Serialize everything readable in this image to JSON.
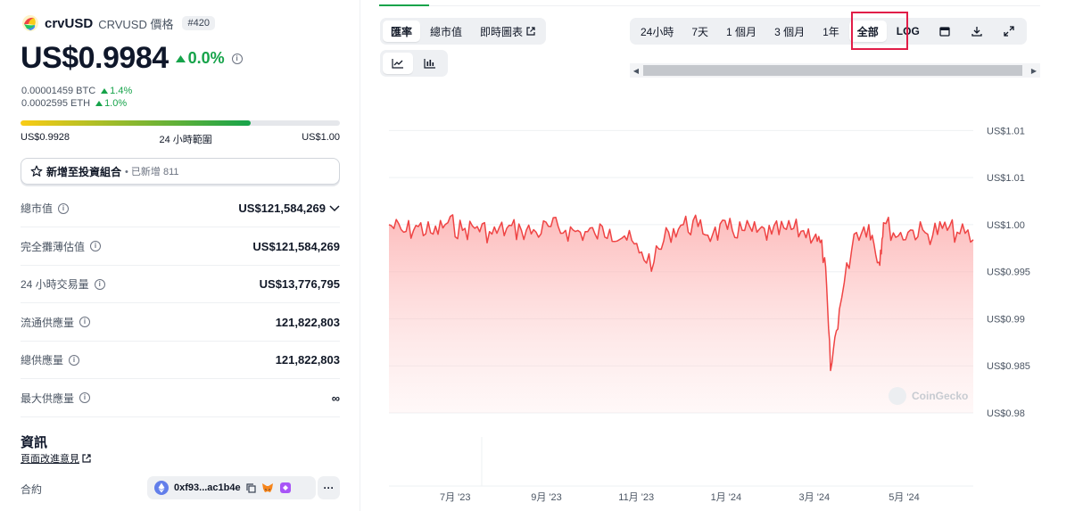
{
  "coin": {
    "name": "crvUSD",
    "symbol_label": "CRVUSD 價格",
    "rank": "#420",
    "price": "US$0.9984",
    "change_24h": "0.0%",
    "btc_price": "0.00001459 BTC",
    "btc_change": "1.4%",
    "eth_price": "0.0002595 ETH",
    "eth_change": "1.0%"
  },
  "range_24h": {
    "low": "US$0.9928",
    "label": "24 小時範圍",
    "high": "US$1.00",
    "fill_fraction": 0.72
  },
  "portfolio": {
    "label": "新增至投資組合",
    "added": "• 已新增 811"
  },
  "stats": [
    {
      "label": "總市值",
      "value": "US$121,584,269",
      "has_dropdown": true
    },
    {
      "label": "完全攤薄估值",
      "value": "US$121,584,269",
      "has_dropdown": false
    },
    {
      "label": "24 小時交易量",
      "value": "US$13,776,795",
      "has_dropdown": false
    },
    {
      "label": "流通供應量",
      "value": "121,822,803",
      "has_dropdown": false
    },
    {
      "label": "總供應量",
      "value": "121,822,803",
      "has_dropdown": false
    },
    {
      "label": "最大供應量",
      "value": "∞",
      "has_dropdown": false
    }
  ],
  "info": {
    "title": "資訊",
    "feedback": "頁面改進意見",
    "contract_label": "合約",
    "contract_address": "0xf93...ac1b4e"
  },
  "chart_controls": {
    "metric_tabs": [
      "匯率",
      "總市值",
      "即時圖表"
    ],
    "active_metric": 0,
    "chart_type_icons": [
      "line-chart-icon",
      "candlestick-chart-icon"
    ],
    "active_chart_type": 0,
    "ranges": [
      "24小時",
      "7天",
      "1 個月",
      "3 個月",
      "1年",
      "全部",
      "LOG"
    ],
    "active_range": 5,
    "tool_icons": [
      "calendar-icon",
      "download-icon",
      "fullscreen-icon"
    ]
  },
  "colors": {
    "line": "#ef4444",
    "positive": "#16a34a",
    "highlight": "#e11d48"
  },
  "watermark": "CoinGecko",
  "chart_data": {
    "type": "area",
    "y_ticks": [
      "US$1.01",
      "US$1.01",
      "US$1.00",
      "US$0.995",
      "US$0.99",
      "US$0.985",
      "US$0.98"
    ],
    "y_tick_values": [
      1.01,
      1.005,
      1.0,
      0.995,
      0.99,
      0.985,
      0.98
    ],
    "ylim": [
      0.98,
      1.0125
    ],
    "x_ticks": [
      "7月 '23",
      "9月 '23",
      "11月 '23",
      "1月 '24",
      "3月 '24",
      "5月 '24"
    ],
    "x_tick_months": [
      "2023-07",
      "2023-09",
      "2023-11",
      "2024-01",
      "2024-03",
      "2024-05"
    ],
    "xlim": [
      "2023-05-17",
      "2024-06-17"
    ],
    "series": [
      {
        "x": [
          "2023-05-17",
          "2023-05-27",
          "2023-06-06",
          "2023-06-16",
          "2023-06-26",
          "2023-07-06",
          "2023-07-16",
          "2023-07-26",
          "2023-08-05",
          "2023-08-15",
          "2023-08-25",
          "2023-09-04",
          "2023-09-14",
          "2023-09-24",
          "2023-10-04",
          "2023-10-14",
          "2023-10-24",
          "2023-11-03",
          "2023-11-13",
          "2023-11-23",
          "2023-12-03",
          "2023-12-13",
          "2023-12-23",
          "2024-01-02",
          "2024-01-12",
          "2024-01-22",
          "2024-02-01",
          "2024-02-11",
          "2024-02-21",
          "2024-03-02",
          "2024-03-08",
          "2024-03-12",
          "2024-03-18",
          "2024-03-28",
          "2024-04-07",
          "2024-04-14",
          "2024-04-17",
          "2024-04-27",
          "2024-05-07",
          "2024-05-17",
          "2024-05-27",
          "2024-06-06",
          "2024-06-17"
        ],
        "y": [
          1.0,
          0.9992,
          0.9998,
          0.999,
          1.0002,
          0.9994,
          0.9998,
          0.999,
          0.9996,
          0.9994,
          0.9992,
          0.9998,
          0.9994,
          0.9992,
          0.999,
          0.9995,
          0.9988,
          0.997,
          0.996,
          0.9992,
          1.0,
          0.9998,
          0.999,
          0.9995,
          0.9994,
          0.9992,
          0.999,
          0.9995,
          0.9993,
          0.999,
          0.9965,
          0.9845,
          0.991,
          0.999,
          1.0,
          0.996,
          1.0002,
          0.9988,
          0.9994,
          0.999,
          0.9996,
          0.9992,
          0.9984
        ]
      }
    ],
    "grid": true
  }
}
